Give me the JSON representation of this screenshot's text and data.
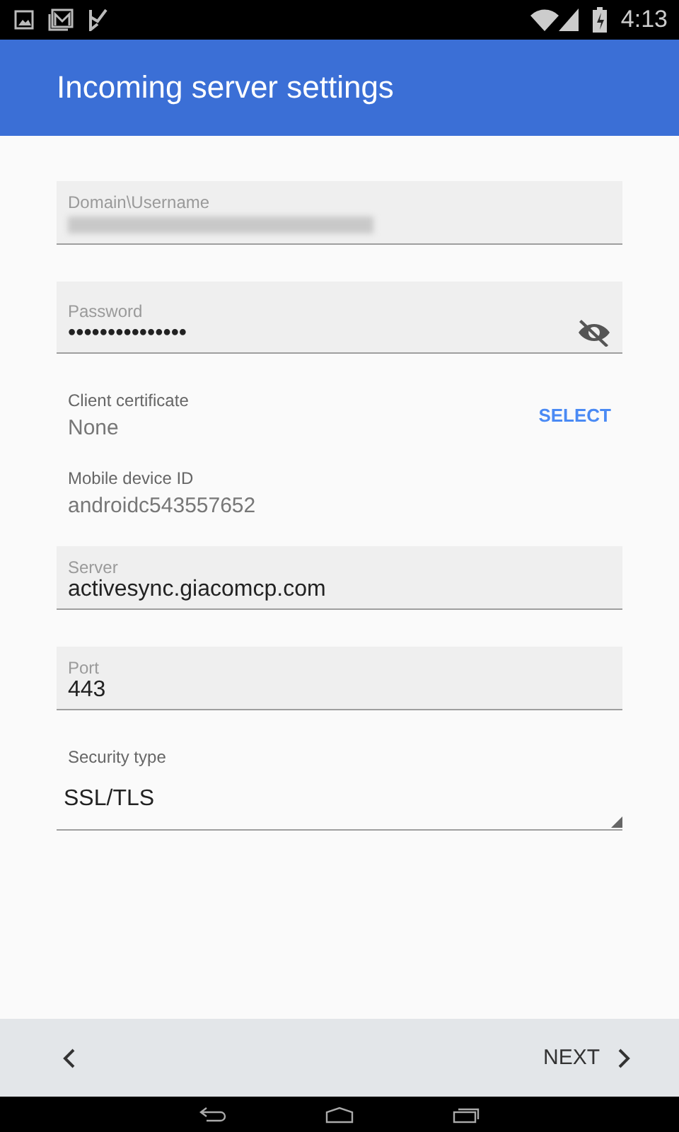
{
  "status_bar": {
    "time": "4:13"
  },
  "app_bar": {
    "title": "Incoming server settings"
  },
  "fields": [
    {
      "kind": "input",
      "label": "Domain\\Username",
      "value_redacted": true
    },
    {
      "kind": "password",
      "label": "Password",
      "value": "•••••••••••••••"
    },
    {
      "kind": "info",
      "label": "Client certificate",
      "value": "None",
      "action": "SELECT"
    },
    {
      "kind": "info",
      "label": "Mobile device ID",
      "value": "androidc543557652"
    },
    {
      "kind": "input",
      "label": "Server",
      "value": "activesync.giacomcp.com"
    },
    {
      "kind": "input",
      "label": "Port",
      "value": "443"
    },
    {
      "kind": "dropdown",
      "label": "Security type",
      "value": "SSL/TLS"
    }
  ],
  "bottom_bar": {
    "next": "NEXT"
  }
}
